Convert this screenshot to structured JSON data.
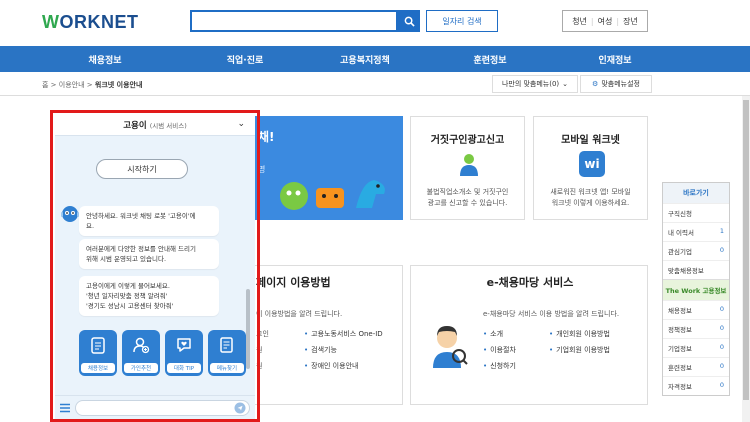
{
  "header": {
    "logo_prefix": "W",
    "logo_rest": "ORKNET",
    "search_placeholder": "",
    "job_search_label": "일자리 검색",
    "audience": [
      "청년",
      "여성",
      "장년"
    ]
  },
  "gnb": [
    "채용정보",
    "직업·진로",
    "고용복지정책",
    "훈련정보",
    "인재정보"
  ],
  "breadcrumb": {
    "home": "홈",
    "level1": "이용안내",
    "current": "워크넷 이용안내"
  },
  "util": {
    "my_menu": "나만의 맞춤메뉴(0)",
    "menu_setting": "맞춤메뉴설정"
  },
  "cards": {
    "banner_tail": "채!",
    "banner_sub": "명",
    "fake_ad_title": "거짓구인광고신고",
    "fake_ad_desc_1": "불법직업소개소 및 거짓구인",
    "fake_ad_desc_2": "광고를 신고할 수 있습니다.",
    "mobile_title": "모바일 워크넷",
    "mobile_desc_1": "새로워진 워크넷 앱! 모바일",
    "mobile_desc_2": "워크넷 이렇게 이용하세요."
  },
  "sections": {
    "page_usage_title": "페이지 이용방법",
    "page_usage_desc": "이 이용방법을 알려 드립니다.",
    "page_usage_left": [
      "그인",
      "원",
      "원"
    ],
    "page_usage_right": [
      "고용노동서비스 One-ID",
      "검색기능",
      "장애인 이용안내"
    ],
    "e_title": "e-채용마당 서비스",
    "e_desc": "e-채용마당 서비스 이용 방법을 알려 드립니다.",
    "e_left": [
      "소개",
      "이용절차",
      "신청하기"
    ],
    "e_right": [
      "개인회원 이용방법",
      "기업회원 이용방법"
    ]
  },
  "quick": {
    "title": "바로가기",
    "rows": [
      {
        "label": "구직신청",
        "value": ""
      },
      {
        "label": "내 이력서",
        "value": "1"
      },
      {
        "label": "관심기업",
        "value": "0"
      },
      {
        "label": "맞춤채용정보",
        "value": ""
      }
    ],
    "work_title": "The Work 고용정보",
    "work_rows": [
      {
        "label": "채용정보",
        "value": "0"
      },
      {
        "label": "정책정보",
        "value": "0"
      },
      {
        "label": "기업정보",
        "value": "0"
      },
      {
        "label": "훈련정보",
        "value": "0"
      },
      {
        "label": "자격정보",
        "value": "0"
      }
    ]
  },
  "chatbot": {
    "title": "고용이",
    "title_sub": "(시범 서비스)",
    "start_label": "시작하기",
    "bubble1": [
      "안녕하세요. 워크넷 채팅 로봇 '고용이'에",
      "요."
    ],
    "bubble2": [
      "여러분에게 다양한 정보를 안내해 드리기",
      "위해 시범 운영되고 있습니다."
    ],
    "bubble3": [
      "고용이에게 이렇게 물어보세요.",
      "'청년 일자리맞춤 정책 알려줘'",
      "'경기도 성남시 고용센터 찾아줘'"
    ],
    "quick_buttons": [
      "채용정보",
      "가인추천",
      "대화 TIP",
      "메뉴찾기"
    ],
    "input_placeholder": ""
  },
  "colors": {
    "brand_blue": "#2a74c4",
    "highlight_red": "#e21a1a",
    "chat_bg": "#eaf3fb"
  }
}
